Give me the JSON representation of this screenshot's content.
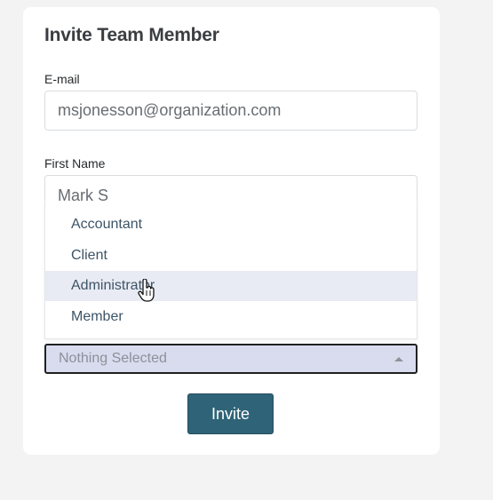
{
  "form": {
    "title": "Invite Team Member",
    "email_label": "E-mail",
    "email_value": "msjonesson@organization.com",
    "first_name_label": "First Name",
    "first_name_value": "Mark S"
  },
  "role_dropdown": {
    "options": [
      "Accountant",
      "Client",
      "Administrator",
      "Member"
    ],
    "highlighted": "Administrator",
    "selected_text": "Nothing Selected"
  },
  "actions": {
    "invite_label": "Invite"
  },
  "colors": {
    "primary_button": "#2f6377",
    "highlight": "#e9ebf4",
    "select_background": "#d9dcee"
  }
}
